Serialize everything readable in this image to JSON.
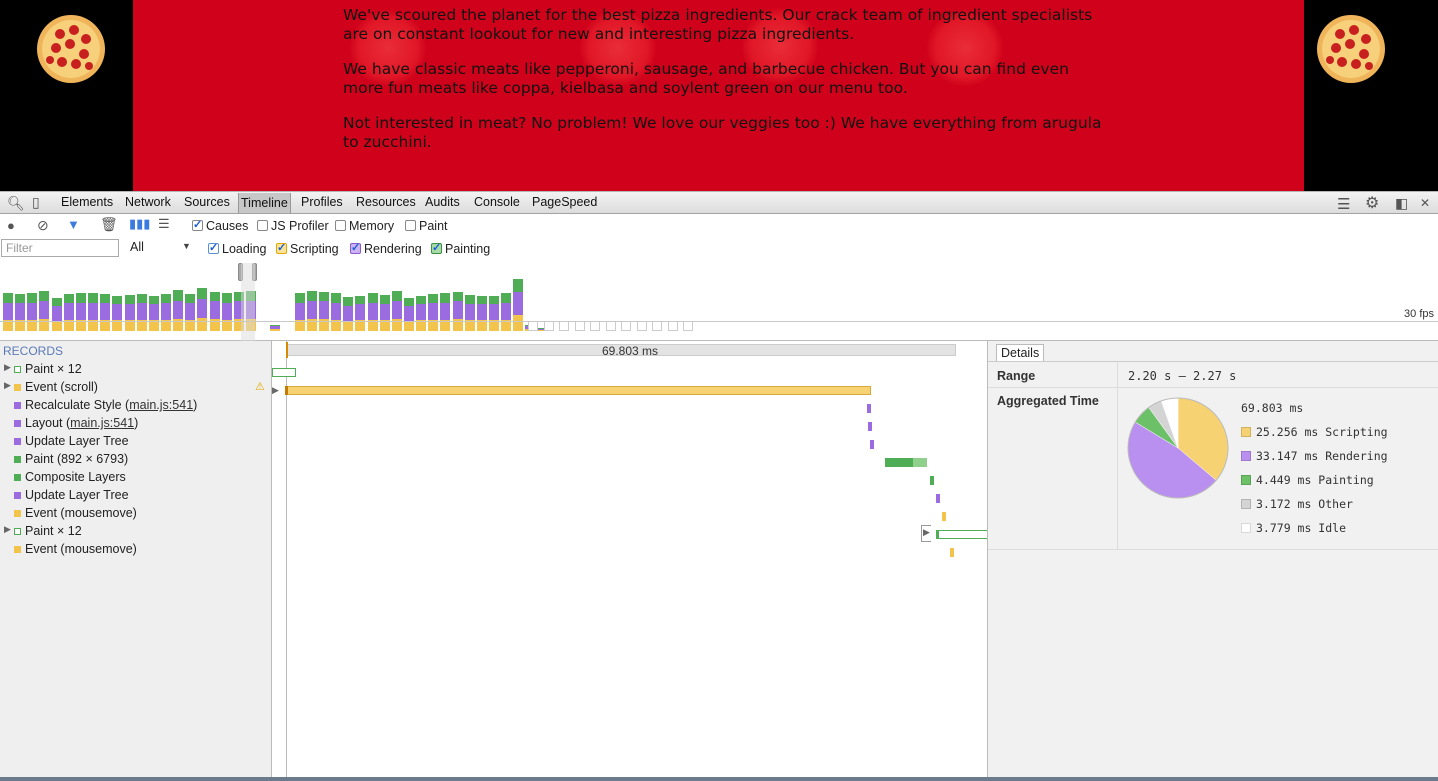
{
  "page": {
    "paragraphs": [
      "We've scoured the planet for the best pizza ingredients. Our crack team of ingredient specialists are on constant lookout for new and interesting pizza ingredients.",
      "We have classic meats like pepperoni, sausage, and barbecue chicken. But you can find even more fun meats like coppa, kielbasa and soylent green on our menu too.",
      "Not interested in meat? No problem! We love our veggies too :) We have everything from arugula to zucchini."
    ]
  },
  "devtools": {
    "tabs": [
      "Elements",
      "Network",
      "Sources",
      "Timeline",
      "Profiles",
      "Resources",
      "Audits",
      "Console",
      "PageSpeed"
    ],
    "active_tab": "Timeline",
    "checkboxes_row1": [
      {
        "label": "Causes",
        "checked": true
      },
      {
        "label": "JS Profiler",
        "checked": false
      },
      {
        "label": "Memory",
        "checked": false
      },
      {
        "label": "Paint",
        "checked": false
      }
    ],
    "filter_placeholder": "Filter",
    "filter_select": "All",
    "categories": [
      {
        "label": "Loading",
        "checked": true,
        "color": "#5b8fd6"
      },
      {
        "label": "Scripting",
        "checked": true,
        "color": "#f3c44b"
      },
      {
        "label": "Rendering",
        "checked": true,
        "color": "#9b6be0"
      },
      {
        "label": "Painting",
        "checked": true,
        "color": "#4fae55"
      }
    ],
    "fps_label": "30 fps",
    "records_header": "RECORDS",
    "records": [
      {
        "label": "Paint × 12",
        "color": "#4fae55",
        "hollow": true,
        "expandable": true
      },
      {
        "label": "Event (scroll)",
        "color": "#f3c44b",
        "expandable": true,
        "warning": true
      },
      {
        "label": "Recalculate Style",
        "link": "main.js:541",
        "color": "#9b6be0"
      },
      {
        "label": "Layout",
        "link": "main.js:541",
        "color": "#9b6be0"
      },
      {
        "label": "Update Layer Tree",
        "color": "#9b6be0"
      },
      {
        "label": "Paint (892 × 6793)",
        "color": "#4fae55"
      },
      {
        "label": "Composite Layers",
        "color": "#4fae55"
      },
      {
        "label": "Update Layer Tree",
        "color": "#9b6be0"
      },
      {
        "label": "Event (mousemove)",
        "color": "#f3c44b"
      },
      {
        "label": "Paint × 12",
        "color": "#4fae55",
        "hollow": true,
        "expandable": true
      },
      {
        "label": "Event (mousemove)",
        "color": "#f3c44b"
      }
    ],
    "ruler_label": "69.803 ms",
    "details": {
      "tab": "Details",
      "range_label": "Range",
      "range_value": "2.20 s – 2.27 s",
      "aggregated_label": "Aggregated Time",
      "total": "69.803 ms",
      "breakdown": [
        {
          "label": "25.256 ms Scripting",
          "value": 25.256,
          "color": "#f7d272"
        },
        {
          "label": "33.147 ms Rendering",
          "value": 33.147,
          "color": "#b98ff0"
        },
        {
          "label": "4.449 ms Painting",
          "value": 4.449,
          "color": "#6cc067"
        },
        {
          "label": "3.172 ms Other",
          "value": 3.172,
          "color": "#d4d4d4"
        },
        {
          "label": "3.779 ms Idle",
          "value": 3.779,
          "color": "#ffffff"
        }
      ]
    }
  }
}
